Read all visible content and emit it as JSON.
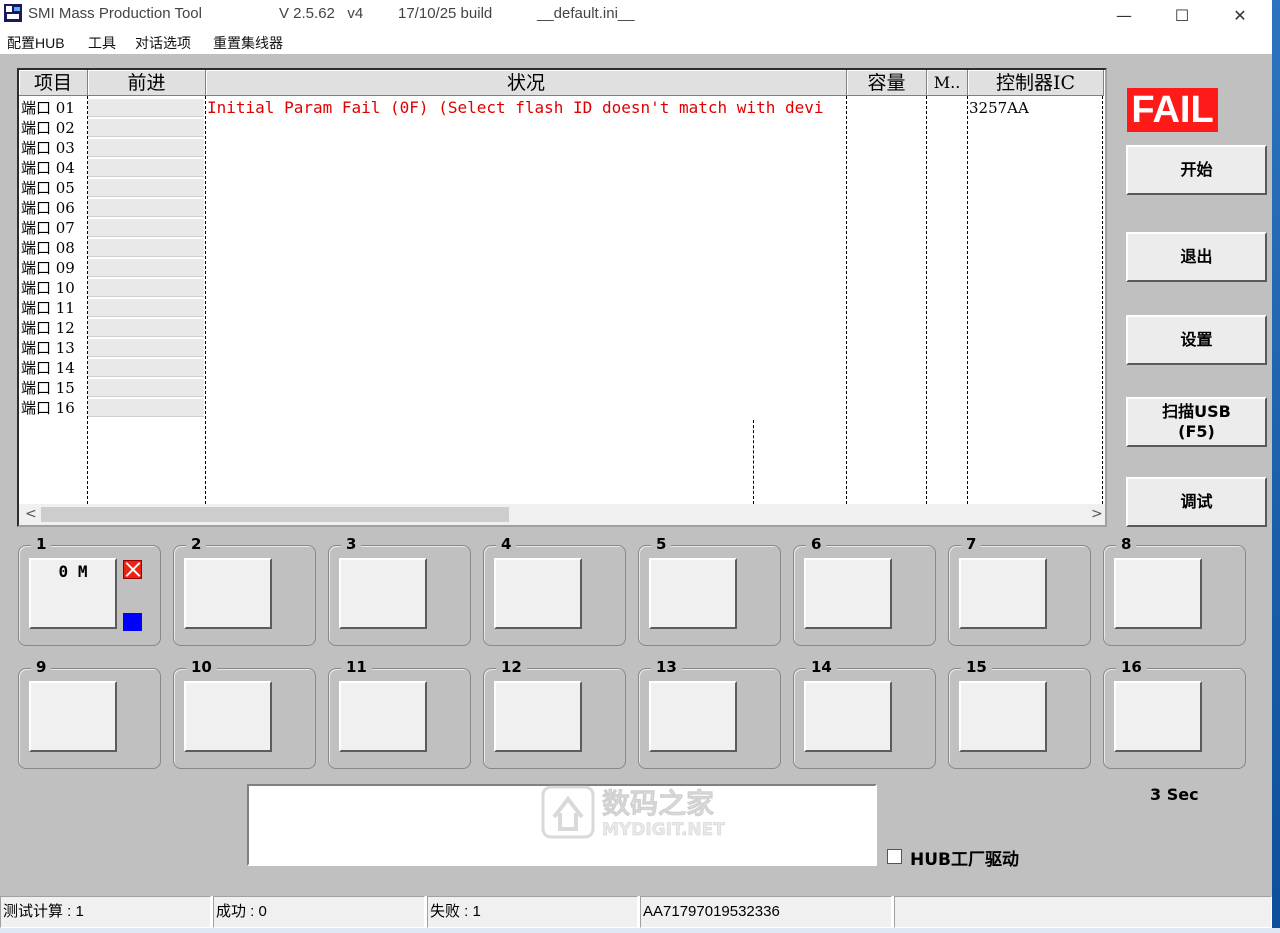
{
  "titlebar": {
    "app_name": "SMI Mass Production Tool",
    "version": "V 2.5.62   v4",
    "build": "17/10/25 build",
    "ini": "__default.ini__",
    "minimize": "—",
    "maximize": "☐",
    "close": "✕"
  },
  "menu": {
    "items": [
      "配置HUB",
      "工具",
      "对话选项",
      "重置集线器"
    ]
  },
  "listview": {
    "columns": [
      "项目",
      "前进",
      "状况",
      "容量",
      "M..",
      "控制器IC"
    ],
    "ports": [
      "端口 01",
      "端口 02",
      "端口 03",
      "端口 04",
      "端口 05",
      "端口 06",
      "端口 07",
      "端口 08",
      "端口 09",
      "端口 10",
      "端口 11",
      "端口 12",
      "端口 13",
      "端口 14",
      "端口 15",
      "端口 16"
    ],
    "row1_status": "Initial Param Fail (0F) (Select flash ID doesn't match with devi",
    "row1_controller": "3257AA",
    "scroll_left": "<",
    "scroll_right": ">"
  },
  "side": {
    "result_badge": "FAIL",
    "result_color": "#ff1a1a",
    "buttons": [
      "开始",
      "退出",
      "设置",
      "扫描USB\n(F5)",
      "调试"
    ],
    "timer": "3 Sec"
  },
  "ports_panel": {
    "groups": [
      "1",
      "2",
      "3",
      "4",
      "5",
      "6",
      "7",
      "8",
      "9",
      "10",
      "11",
      "12",
      "13",
      "14",
      "15",
      "16"
    ],
    "port1_capacity": "0 M",
    "port1_status_icon": "red-x",
    "port1_led_color": "#0000ff"
  },
  "message": {
    "text": "",
    "watermark_cn": "数码之家",
    "watermark_en": "MYDIGIT.NET"
  },
  "hub_driver": {
    "label": "HUB工厂驱动",
    "checked": false
  },
  "statusbar": {
    "count_label": "测试计算 : 1",
    "success_label": "成功 : 0",
    "fail_label": "失败 : 1",
    "serial": "AA71797019532336",
    "extra": ""
  }
}
